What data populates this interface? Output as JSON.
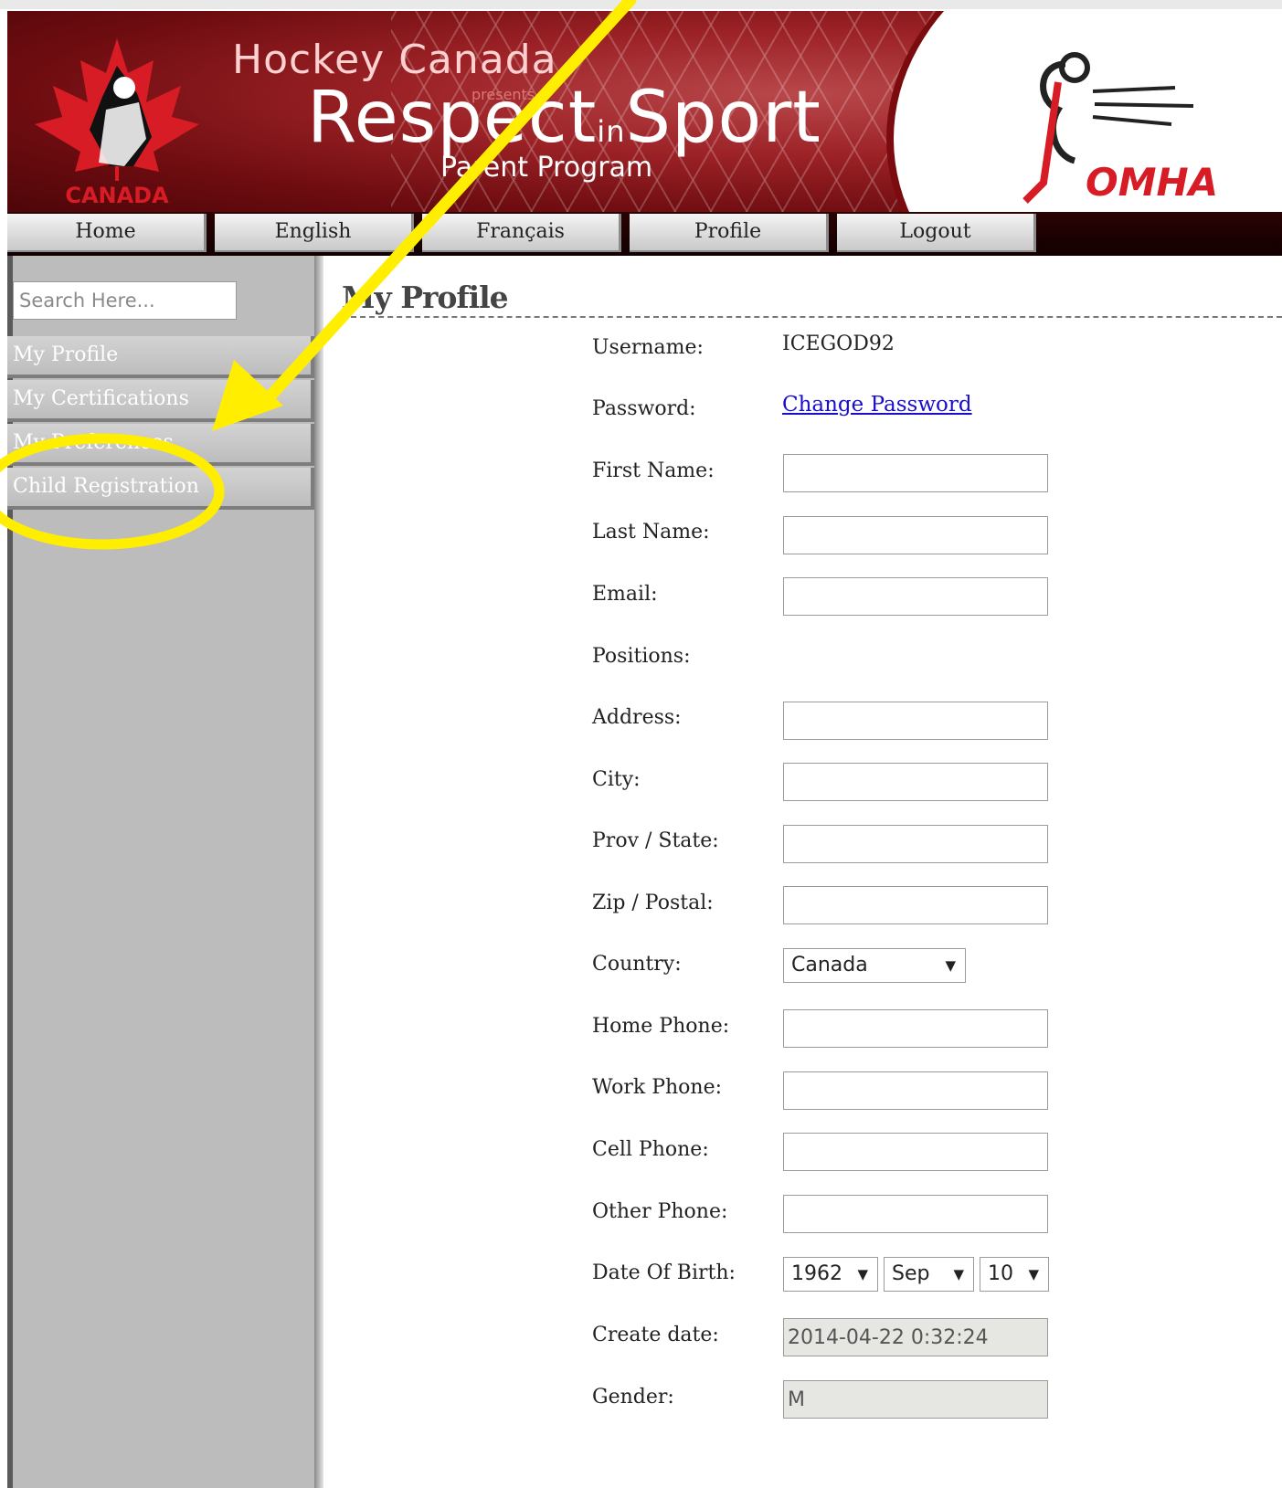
{
  "header": {
    "hc_text": "Hockey Canada",
    "presents_text": "presents",
    "program_main": "Respect",
    "program_in": "in",
    "program_sport": "Sport",
    "program_sub": "Parent Program",
    "hc_logo_text": "CANADA",
    "omha_logo_text": "OMHA"
  },
  "nav": {
    "items": [
      "Home",
      "English",
      "Français",
      "Profile",
      "Logout"
    ]
  },
  "sidebar": {
    "search_placeholder": "Search Here...",
    "items": [
      "My Profile",
      "My Certifications",
      "My Preferences",
      "Child Registration"
    ]
  },
  "main": {
    "title": "My Profile",
    "fields": {
      "username_label": "Username:",
      "username_value": "ICEGOD92",
      "password_label": "Password:",
      "password_link": "Change Password",
      "first_name_label": "First Name:",
      "last_name_label": "Last Name:",
      "email_label": "Email:",
      "positions_label": "Positions:",
      "address_label": "Address:",
      "city_label": "City:",
      "prov_label": "Prov / State:",
      "zip_label": "Zip / Postal:",
      "country_label": "Country:",
      "country_value": "Canada",
      "home_phone_label": "Home Phone:",
      "work_phone_label": "Work Phone:",
      "cell_phone_label": "Cell Phone:",
      "other_phone_label": "Other Phone:",
      "dob_label": "Date Of Birth:",
      "dob_year": "1962",
      "dob_month": "Sep",
      "dob_day": "10",
      "create_date_label": "Create date:",
      "create_date_value": "2014-04-22 0:32:24",
      "gender_label": "Gender:",
      "gender_value": "M"
    }
  },
  "colors": {
    "banner_red": "#9c2226",
    "annotation_yellow": "#ffee00",
    "link_blue": "#1a0dcc"
  }
}
